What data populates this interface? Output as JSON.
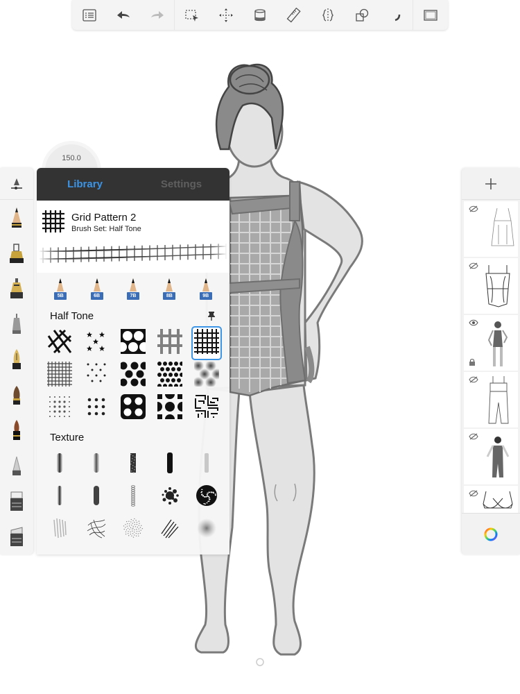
{
  "toolbar": {
    "buttons": [
      {
        "name": "brush-library-list",
        "icon": "list-icon"
      },
      {
        "name": "undo",
        "icon": "undo-arrow-icon"
      },
      {
        "name": "redo",
        "icon": "redo-arrow-icon"
      },
      {
        "name": "selection",
        "icon": "selection-icon"
      },
      {
        "name": "transform",
        "icon": "move-icon"
      },
      {
        "name": "fill",
        "icon": "paint-bucket-icon"
      },
      {
        "name": "guides",
        "icon": "ruler-icon"
      },
      {
        "name": "symmetry",
        "icon": "symmetry-icon"
      },
      {
        "name": "shapes",
        "icon": "shapes-icon"
      },
      {
        "name": "curve",
        "icon": "curve-icon"
      },
      {
        "name": "full-screen",
        "icon": "frame-icon"
      }
    ]
  },
  "puck": {
    "size_value": "150.0"
  },
  "brush_rail": {
    "tools": [
      "brush-settings",
      "pencil",
      "inking-pen",
      "technical-pen",
      "ballpoint-pen",
      "fountain-pen",
      "paintbrush",
      "marker-brush",
      "airbrush",
      "eraser",
      "eraser-wedge"
    ]
  },
  "brush_panel": {
    "tabs": [
      {
        "label": "Library",
        "active": true
      },
      {
        "label": "Settings",
        "active": false
      }
    ],
    "current_brush": {
      "name": "Grid Pattern 2",
      "set": "Brush Set: Half Tone"
    },
    "pencil_presets": [
      "5B",
      "6B",
      "7B",
      "8B",
      "9B"
    ],
    "sections": [
      {
        "title": "Half Tone",
        "pinned": true,
        "brushes": [
          "diamond-lattice",
          "stars",
          "hexagon-holes",
          "soft-grid",
          "grid-pattern-2",
          "fine-grid",
          "sparse-dots",
          "large-dot-stagger",
          "dense-dots",
          "soft-dots",
          "small-dots-fade",
          "square-dots",
          "big-ring-dots",
          "half-circles",
          "maze"
        ],
        "selected_index": 4
      },
      {
        "title": "Texture",
        "pinned": false,
        "brushes": [
          "soft-stroke-1",
          "soft-stroke-2",
          "rough-stroke",
          "solid-stroke",
          "light-stroke",
          "soft-stroke-3",
          "dark-stroke",
          "bead-stroke",
          "splatter",
          "noise-blob",
          "hatch-soft",
          "scribble",
          "grain",
          "diagonal-hatch",
          "fuzz"
        ]
      }
    ]
  },
  "layers": {
    "add_label": "+",
    "items": [
      {
        "name": "dress-sketch",
        "visible": false,
        "locked": false
      },
      {
        "name": "swimsuit-outline",
        "visible": false,
        "locked": false
      },
      {
        "name": "figure-with-swimsuit",
        "visible": true,
        "locked": true
      },
      {
        "name": "overalls-outline",
        "visible": false,
        "locked": false
      },
      {
        "name": "figure-with-overalls",
        "visible": false,
        "locked": false
      },
      {
        "name": "bra-outline",
        "visible": false,
        "locked": false
      }
    ]
  },
  "colors": {
    "accent": "#3b94e6",
    "panel_tabs_bg": "#333333",
    "skin": "#e3e3e3",
    "outline": "#7a7a7a",
    "garment": "#8f8f8f"
  }
}
